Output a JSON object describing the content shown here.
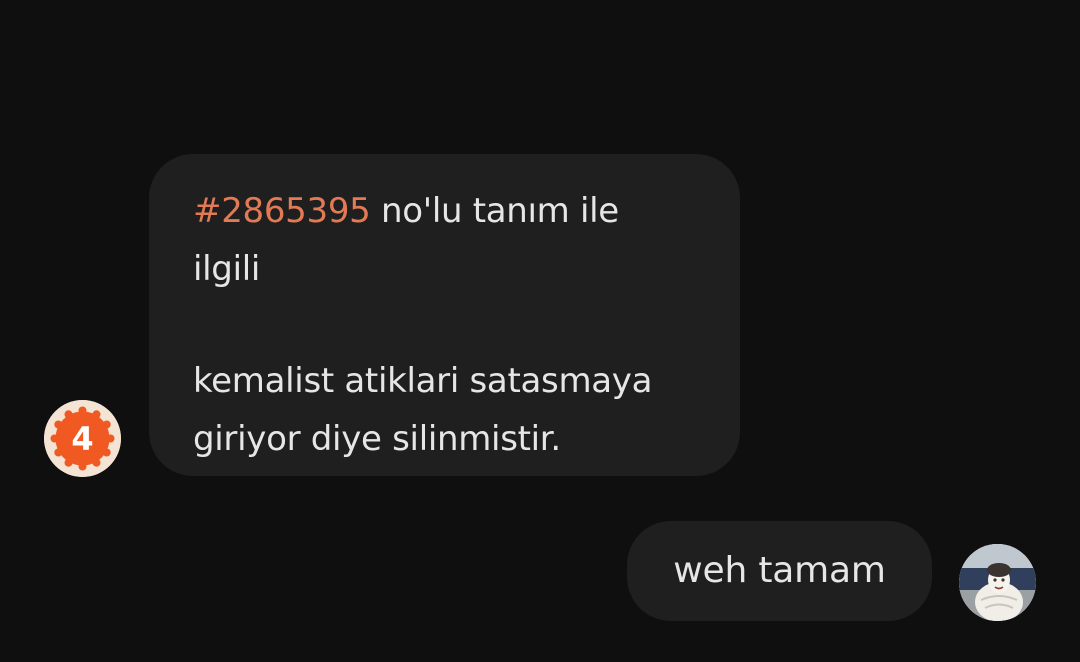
{
  "messages": [
    {
      "direction": "incoming",
      "link_text": "#2865395",
      "line1_rest": " no'lu tanım ile",
      "line2": "ilgili",
      "line3": "kemalist atiklari satasmaya",
      "line4": "giriyor diye silinmistir."
    },
    {
      "direction": "outgoing",
      "text": "weh tamam"
    }
  ],
  "avatars": {
    "bot_badge": "4",
    "bot_icon": "orange-badge-icon",
    "user_icon": "profile-photo"
  },
  "colors": {
    "background": "#0f0f10",
    "bubble": "#1f1f20",
    "text": "#e6e6e6",
    "link": "#e27a55",
    "badge_orange": "#f05a22"
  }
}
